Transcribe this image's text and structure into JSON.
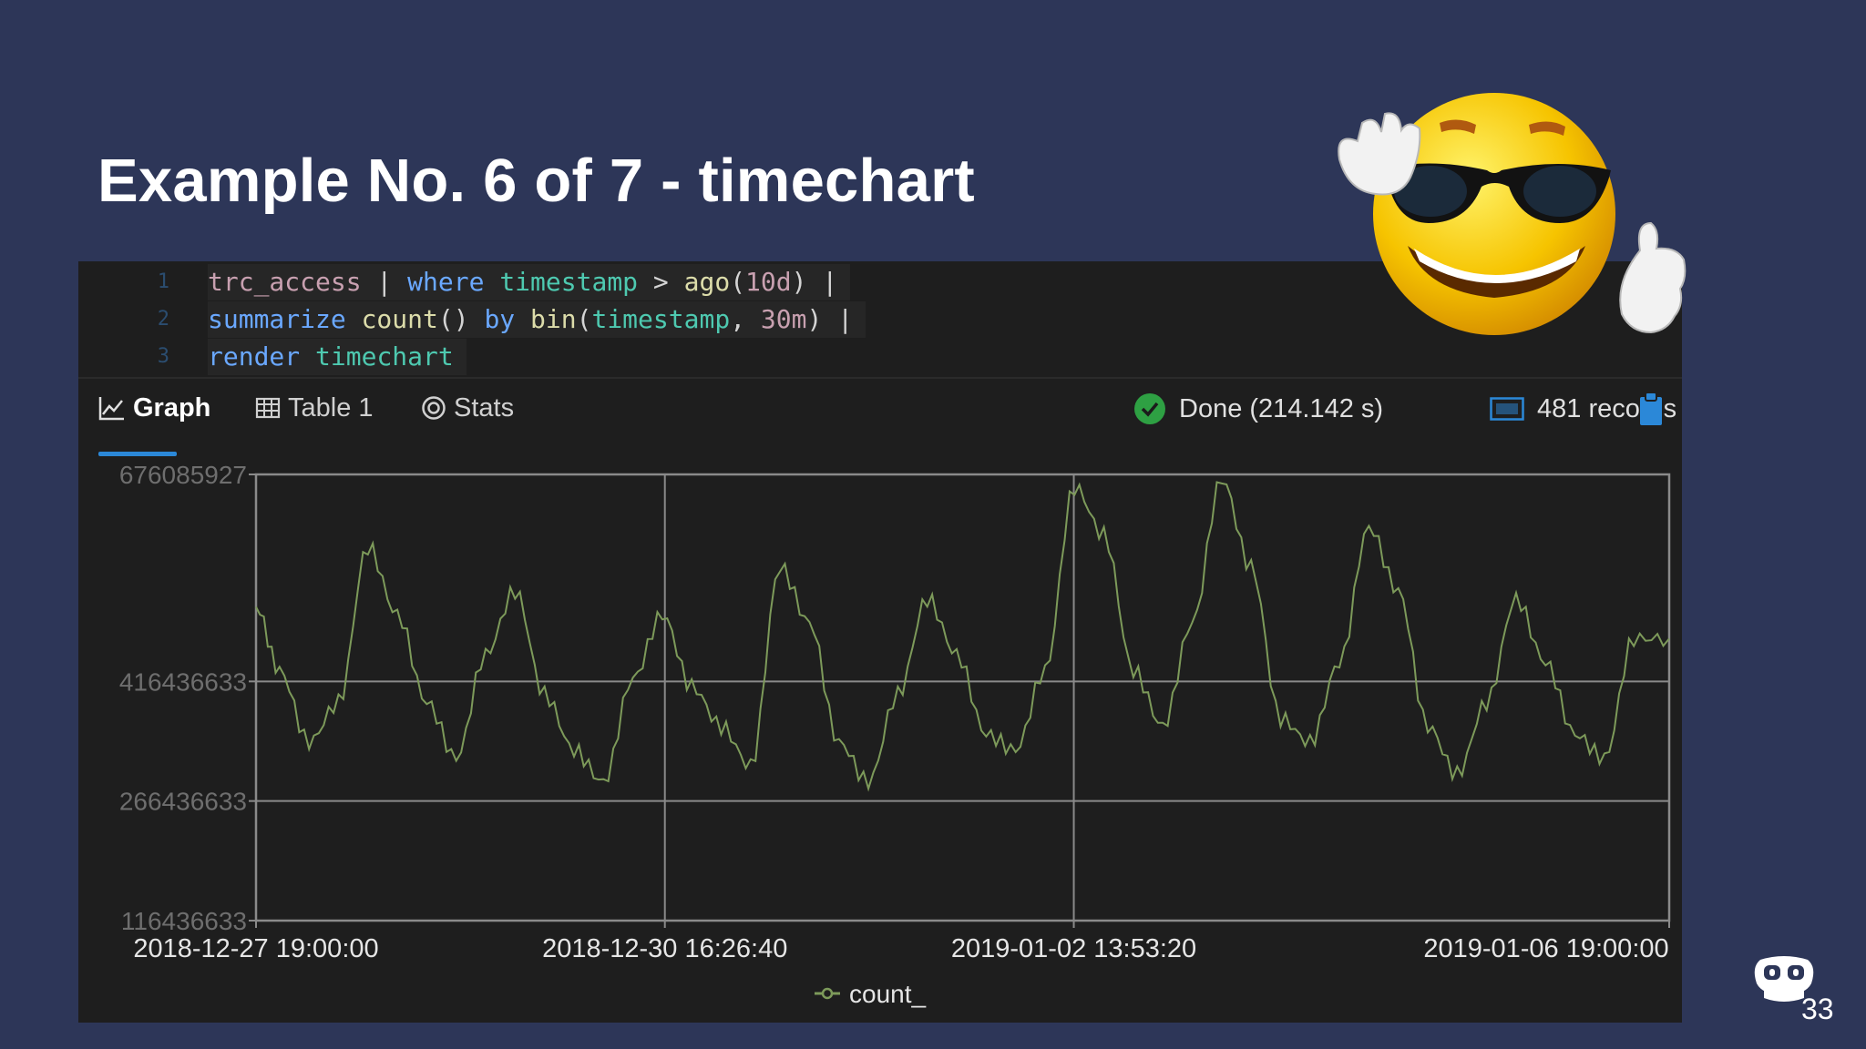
{
  "slide": {
    "title": "Example No. 6 of 7 - timechart",
    "page_number": "33"
  },
  "editor": {
    "lines": [
      {
        "number": "1",
        "text": "trc_access | where timestamp > ago(10d) |"
      },
      {
        "number": "2",
        "text": "summarize count() by bin(timestamp, 30m) |"
      },
      {
        "number": "3",
        "text": "render timechart"
      }
    ]
  },
  "tabs": [
    {
      "label": "Graph",
      "icon": "line-chart-icon",
      "active": true
    },
    {
      "label": "Table 1",
      "icon": "table-icon",
      "active": false
    },
    {
      "label": "Stats",
      "icon": "stats-icon",
      "active": false
    }
  ],
  "status": {
    "done_text": "Done (214.142 s)",
    "records_text": "481 records",
    "icons": [
      "check-circle-icon",
      "records-counter-icon",
      "clipboard-icon"
    ]
  },
  "colors": {
    "background": "#2d3658",
    "panel": "#1e1e1e",
    "accent": "#2b88d8",
    "series": "#7d9a5a",
    "done_green": "#2ea043"
  },
  "chart_data": {
    "type": "line",
    "y_tick_labels": [
      "676085927",
      "416436633",
      "266436633",
      "116436633"
    ],
    "x_tick_labels": [
      "2018-12-27 19:00:00",
      "2018-12-30 16:26:40",
      "2019-01-02 13:53:20",
      "2019-01-06 19:00:00"
    ],
    "ylim": [
      116436633,
      676085927
    ],
    "grid": true,
    "legend_position": "bottom",
    "series": [
      {
        "name": "count_",
        "x": [
          "2018-12-27 19:00",
          "2018-12-27 23:00",
          "2018-12-28 04:00",
          "2018-12-28 09:00",
          "2018-12-28 14:00",
          "2018-12-28 19:00",
          "2018-12-29 00:00",
          "2018-12-29 05:00",
          "2018-12-29 10:00",
          "2018-12-29 15:00",
          "2018-12-29 20:00",
          "2018-12-30 01:00",
          "2018-12-30 06:00",
          "2018-12-30 11:00",
          "2018-12-30 16:00",
          "2018-12-30 21:00",
          "2018-12-31 02:00",
          "2018-12-31 07:00",
          "2018-12-31 12:00",
          "2018-12-31 17:00",
          "2018-12-31 22:00",
          "2019-01-01 03:00",
          "2019-01-01 08:00",
          "2019-01-01 13:00",
          "2019-01-01 18:00",
          "2019-01-01 23:00",
          "2019-01-02 04:00",
          "2019-01-02 09:00",
          "2019-01-02 14:00",
          "2019-01-02 19:00",
          "2019-01-03 00:00",
          "2019-01-03 05:00",
          "2019-01-03 10:00",
          "2019-01-03 15:00",
          "2019-01-03 20:00",
          "2019-01-04 01:00",
          "2019-01-04 06:00",
          "2019-01-04 11:00",
          "2019-01-04 16:00",
          "2019-01-04 21:00",
          "2019-01-05 02:00",
          "2019-01-05 07:00",
          "2019-01-05 12:00",
          "2019-01-05 17:00",
          "2019-01-05 22:00",
          "2019-01-06 03:00",
          "2019-01-06 08:00",
          "2019-01-06 13:00",
          "2019-01-06 19:00"
        ],
        "values": [
          510000000,
          430000000,
          340000000,
          390000000,
          585000000,
          500000000,
          390000000,
          320000000,
          450000000,
          530000000,
          400000000,
          330000000,
          290000000,
          420000000,
          500000000,
          410000000,
          360000000,
          310000000,
          560000000,
          490000000,
          340000000,
          290000000,
          400000000,
          520000000,
          450000000,
          350000000,
          330000000,
          430000000,
          660000000,
          600000000,
          430000000,
          360000000,
          490000000,
          670000000,
          560000000,
          370000000,
          340000000,
          440000000,
          610000000,
          530000000,
          360000000,
          300000000,
          390000000,
          520000000,
          440000000,
          350000000,
          320000000,
          470000000,
          470000000
        ]
      }
    ]
  }
}
